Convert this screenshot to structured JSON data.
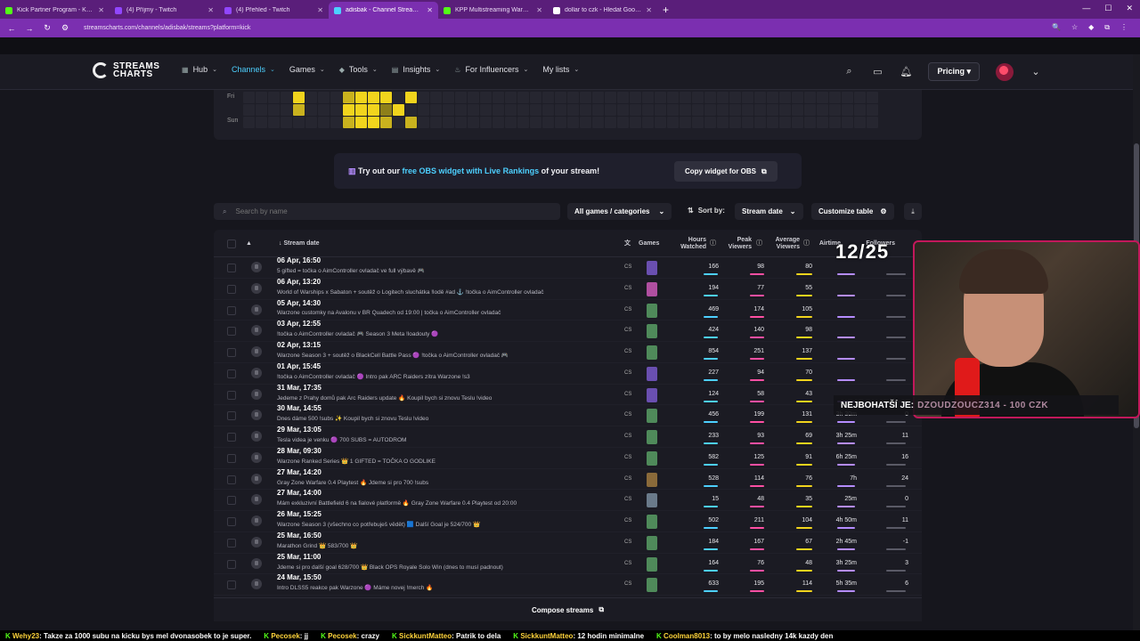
{
  "browser": {
    "tabs": [
      {
        "title": "Kick Partner Program - Kick Da",
        "color": "#53fc18",
        "active": false
      },
      {
        "title": "(4) Příjmy - Twitch",
        "color": "#9146ff",
        "active": false
      },
      {
        "title": "(4) Přehled - Twitch",
        "color": "#9146ff",
        "active": false
      },
      {
        "title": "adisbak - Channel Streams on K",
        "color": "#4dd0ff",
        "active": true
      },
      {
        "title": "KPP Multistreaming Warning -",
        "color": "#53fc18",
        "active": false
      },
      {
        "title": "dollar to czk - Hledat Googlem",
        "color": "#ffffff",
        "active": false
      }
    ],
    "new_tab": "+",
    "url": "streamscharts.com/channels/adisbak/streams?platform=kick"
  },
  "site": {
    "logo_text": "STREAMS CHARTS",
    "nav": [
      {
        "label": "Hub",
        "active": false
      },
      {
        "label": "Channels",
        "active": true
      },
      {
        "label": "Games",
        "active": false
      },
      {
        "label": "Tools",
        "active": false
      },
      {
        "label": "Insights",
        "active": false
      },
      {
        "label": "For Influencers",
        "active": false
      },
      {
        "label": "My lists",
        "active": false
      }
    ],
    "pricing": "Pricing"
  },
  "heatmap": {
    "labels": [
      "Fri",
      "Sun"
    ]
  },
  "promo": {
    "prefix": "Try out our",
    "link": "free OBS widget with Live Rankings",
    "suffix": "of your stream!",
    "button": "Copy widget for OBS"
  },
  "controls": {
    "search_placeholder": "Search by name",
    "games_filter": "All games / categories",
    "sort_label": "Sort by:",
    "sort_value": "Stream date",
    "customize": "Customize table"
  },
  "table": {
    "headers": {
      "stream_date": "Stream date",
      "games": "Games",
      "hours_watched": "Hours Watched",
      "peak_viewers": "Peak Viewers",
      "avg_viewers": "Average Viewers",
      "airtime": "Airtime",
      "followers": "Followers"
    },
    "rows": [
      {
        "date": "06 Apr, 16:50",
        "title": "5 gifted = točka o AimController ovladač ve full výbavě 🎮",
        "plat": "CS",
        "game": "#6a4fb0",
        "hw": "166",
        "peak": "98",
        "avg": "80",
        "air": "",
        "fol": ""
      },
      {
        "date": "06 Apr, 13:20",
        "title": "World of Warships x Sabaton + soutěž o Logitech sluchátka !lodě #ad ⚓ !točka o AimController ovladač",
        "plat": "CS",
        "game": "#b04fa0",
        "hw": "194",
        "peak": "77",
        "avg": "55",
        "air": "",
        "fol": ""
      },
      {
        "date": "05 Apr, 14:30",
        "title": "Warzone customky na Avalonu v BR Quadech od 19:00 | točka o AimController ovladač",
        "plat": "CS",
        "game": "#4f8a5a",
        "hw": "469",
        "peak": "174",
        "avg": "105",
        "air": "",
        "fol": ""
      },
      {
        "date": "03 Apr, 12:55",
        "title": "!točka o AimController ovladač 🎮 Season 3 Meta !loadouty 🟣",
        "plat": "CS",
        "game": "#4f8a5a",
        "hw": "424",
        "peak": "140",
        "avg": "98",
        "air": "",
        "fol": ""
      },
      {
        "date": "02 Apr, 13:15",
        "title": "Warzone Season 3 + soutěž o BlackCell Battle Pass 🟣 !točka o AimController ovladač 🎮",
        "plat": "CS",
        "game": "#4f8a5a",
        "hw": "854",
        "peak": "251",
        "avg": "137",
        "air": "",
        "fol": ""
      },
      {
        "date": "01 Apr, 15:45",
        "title": "!točka o AimController ovladač 🟣 Intro pak ARC Raiders zítra Warzone !s3",
        "plat": "CS",
        "game": "#6a4fb0",
        "hw": "227",
        "peak": "94",
        "avg": "70",
        "air": "",
        "fol": ""
      },
      {
        "date": "31 Mar, 17:35",
        "title": "Jedeme z Prahy domů pak Arc Raiders update 🔥 Koupil bych si znovu Teslu !video",
        "plat": "CS",
        "game": "#6a4fb0",
        "hw": "124",
        "peak": "58",
        "avg": "43",
        "air": "",
        "fol": ""
      },
      {
        "date": "30 Mar, 14:55",
        "title": "Dnes dáme 500 !subs ✨ Koupil bych si znovu Teslu !video",
        "plat": "CS",
        "game": "#4f8a5a",
        "hw": "456",
        "peak": "199",
        "avg": "131",
        "air": "3h 30m",
        "fol": "0"
      },
      {
        "date": "29 Mar, 13:05",
        "title": "Tesla videa je venku 🟣 700 SUBS = AUTODROM",
        "plat": "CS",
        "game": "#4f8a5a",
        "hw": "233",
        "peak": "93",
        "avg": "69",
        "air": "3h 25m",
        "fol": "11"
      },
      {
        "date": "28 Mar, 09:30",
        "title": "Warzone Ranked Series 👑 1 GIFTED = TOČKA O GODLIKE",
        "plat": "CS",
        "game": "#4f8a5a",
        "hw": "582",
        "peak": "125",
        "avg": "91",
        "air": "6h 25m",
        "fol": "16"
      },
      {
        "date": "27 Mar, 14:20",
        "title": "Gray Zone Warfare 0.4 Playtest 🔥 Jdeme si pro 700 !subs",
        "plat": "CS",
        "game": "#8a6a3a",
        "hw": "528",
        "peak": "114",
        "avg": "76",
        "air": "7h",
        "fol": "24"
      },
      {
        "date": "27 Mar, 14:00",
        "title": "Mám exkluzivní Battlefield 6 na fialové platformě 🔥 Gray Zone Warfare 0.4 Playtest od 20:00",
        "plat": "CS",
        "game": "#6a7a8a",
        "hw": "15",
        "peak": "48",
        "avg": "35",
        "air": "25m",
        "fol": "0"
      },
      {
        "date": "26 Mar, 15:25",
        "title": "Warzone Season 3 (všechno co potřebuješ vědět) 🟦 Další Goal je 524/700 👑",
        "plat": "CS",
        "game": "#4f8a5a",
        "hw": "502",
        "peak": "211",
        "avg": "104",
        "air": "4h 50m",
        "fol": "11"
      },
      {
        "date": "25 Mar, 16:50",
        "title": "Marathon Grind 👑 583/700 👑",
        "plat": "CS",
        "game": "#4f8a5a",
        "hw": "184",
        "peak": "167",
        "avg": "67",
        "air": "2h 45m",
        "fol": "-1"
      },
      {
        "date": "25 Mar, 11:00",
        "title": "Jdeme si pro další goal 628/700 👑 Black OPS Royale Solo Win (dnes to musí padnout)",
        "plat": "CS",
        "game": "#4f8a5a",
        "hw": "164",
        "peak": "76",
        "avg": "48",
        "air": "3h 25m",
        "fol": "3"
      },
      {
        "date": "24 Mar, 15:50",
        "title": "Intro DLSS5 reakce pak Warzone 🟣 Máme novej !merch 🔥",
        "plat": "CS",
        "game": "#4f8a5a",
        "hw": "633",
        "peak": "195",
        "avg": "114",
        "air": "5h 35m",
        "fol": "6"
      }
    ],
    "compose": "Compose streams"
  },
  "overlay": {
    "counter": "12/25",
    "richest_label": "NEJBOHATŠÍ JE:",
    "richest_who": "DZOUDZOUCZ314 - 100 CZK",
    "chat": [
      {
        "user": "Wehy23",
        "msg": "Takze za 1000 subu na kicku bys mel dvonasobek to je super."
      },
      {
        "user": "Pecosek",
        "msg": "jj"
      },
      {
        "user": "Pecosek",
        "msg": "crazy"
      },
      {
        "user": "SickkuntMatteo",
        "msg": "Patrik to dela"
      },
      {
        "user": "SickkuntMatteo",
        "msg": "12 hodin minimalne"
      },
      {
        "user": "Coolman8013",
        "msg": "to by melo nasledny 14k kazdy den"
      }
    ]
  },
  "colors": {
    "accent": "#4dd0ff",
    "browser": "#7b2fb0",
    "heat": "#f1d41d",
    "kick": "#53fc18"
  }
}
